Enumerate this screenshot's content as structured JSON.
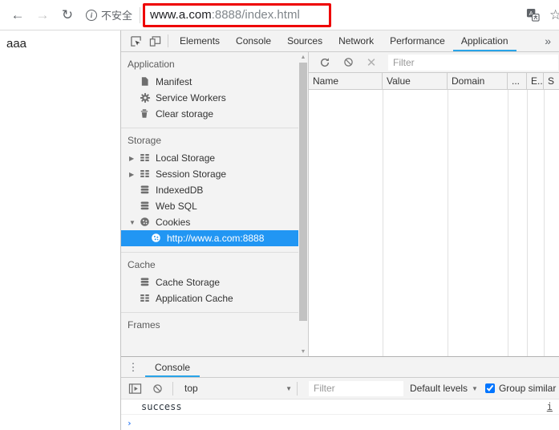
{
  "browser": {
    "security_label": "不安全",
    "url_host": "www.a.com",
    "url_rest": ":8888/index.html",
    "annotation_color": "#ee0000"
  },
  "page": {
    "content": "aaa"
  },
  "icons": {
    "back": "←",
    "forward": "→",
    "reload": "↻",
    "info": "i",
    "star": "☆",
    "more_tabs": "»",
    "overflow_menu": "⋮",
    "dropdown_arrow": "▼",
    "collapsed_arrow": "▶",
    "expanded_arrow": "▼",
    "scroll_up": "▲",
    "scroll_down": "▼",
    "delete_x": "✕",
    "prompt": "›"
  },
  "colors": {
    "selection_blue": "#2196f3",
    "tab_underline": "#29a4e8"
  },
  "devtools": {
    "tabs": [
      {
        "label": "Elements",
        "selected": false
      },
      {
        "label": "Console",
        "selected": false
      },
      {
        "label": "Sources",
        "selected": false
      },
      {
        "label": "Network",
        "selected": false
      },
      {
        "label": "Performance",
        "selected": false
      },
      {
        "label": "Application",
        "selected": true
      }
    ],
    "sidebar": {
      "sections": [
        {
          "title": "Application",
          "items": [
            {
              "label": "Manifest",
              "icon": "file"
            },
            {
              "label": "Service Workers",
              "icon": "gear"
            },
            {
              "label": "Clear storage",
              "icon": "trash"
            }
          ]
        },
        {
          "title": "Storage",
          "items": [
            {
              "label": "Local Storage",
              "icon": "table",
              "arrow": "collapsed"
            },
            {
              "label": "Session Storage",
              "icon": "table",
              "arrow": "collapsed"
            },
            {
              "label": "IndexedDB",
              "icon": "database"
            },
            {
              "label": "Web SQL",
              "icon": "database"
            },
            {
              "label": "Cookies",
              "icon": "cookie",
              "arrow": "expanded"
            },
            {
              "label": "http://www.a.com:8888",
              "icon": "cookie",
              "child": true,
              "selected": true
            }
          ]
        },
        {
          "title": "Cache",
          "items": [
            {
              "label": "Cache Storage",
              "icon": "database"
            },
            {
              "label": "Application Cache",
              "icon": "table"
            }
          ]
        },
        {
          "title": "Frames",
          "items": []
        }
      ]
    },
    "cookies": {
      "filter_placeholder": "Filter",
      "columns": [
        "Name",
        "Value",
        "Domain",
        "...",
        "E...",
        "S"
      ]
    },
    "console": {
      "tab_label": "Console",
      "context": "top",
      "filter_placeholder": "Filter",
      "levels_label": "Default levels",
      "group_similar_label": "Group similar",
      "group_similar_checked": true,
      "messages": [
        {
          "text": "success",
          "link": "i"
        }
      ]
    }
  }
}
